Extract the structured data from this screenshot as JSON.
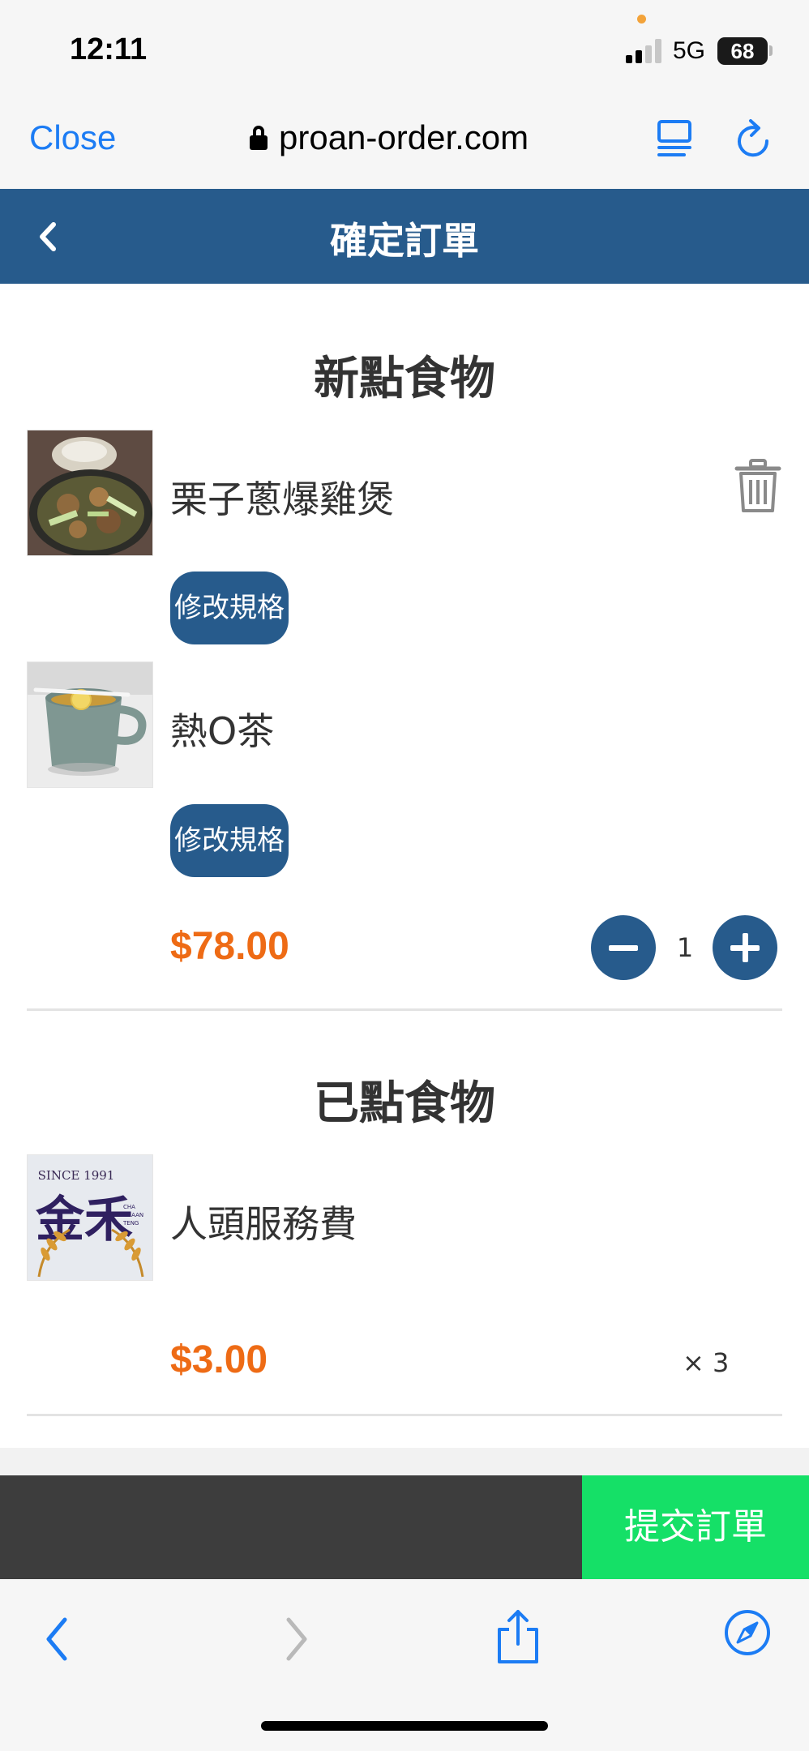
{
  "status_bar": {
    "time": "12:11",
    "network": "5G",
    "battery": "68"
  },
  "browser": {
    "close_label": "Close",
    "url": "proan-order.com"
  },
  "app_header": {
    "title": "確定訂單"
  },
  "new_items": {
    "title": "新點食物",
    "items": [
      {
        "name": "栗子蔥爆雞煲",
        "spec_button": "修改規格"
      },
      {
        "name": "熱O茶",
        "spec_button": "修改規格"
      }
    ],
    "price": "$78.00",
    "quantity": "1"
  },
  "ordered_items": {
    "title": "已點食物",
    "items": [
      {
        "name": "人頭服務費",
        "price": "$3.00",
        "quantity_text": "× 3"
      }
    ]
  },
  "logo": {
    "text_top": "SINCE 1991",
    "text_main": "金禾",
    "text_side": "CHA CHAAN TENG"
  },
  "action_bar": {
    "submit_label": "提交訂單"
  },
  "colors": {
    "brand_blue": "#275b8c",
    "price_orange": "#ee6b15",
    "submit_green": "#15e067",
    "link_blue": "#1c7cf4"
  },
  "icons": [
    "lock-icon",
    "reader-icon",
    "reload-icon",
    "back-chevron-icon",
    "trash-icon",
    "minus-icon",
    "plus-icon",
    "nav-back-icon",
    "nav-forward-icon",
    "share-icon",
    "compass-icon"
  ]
}
